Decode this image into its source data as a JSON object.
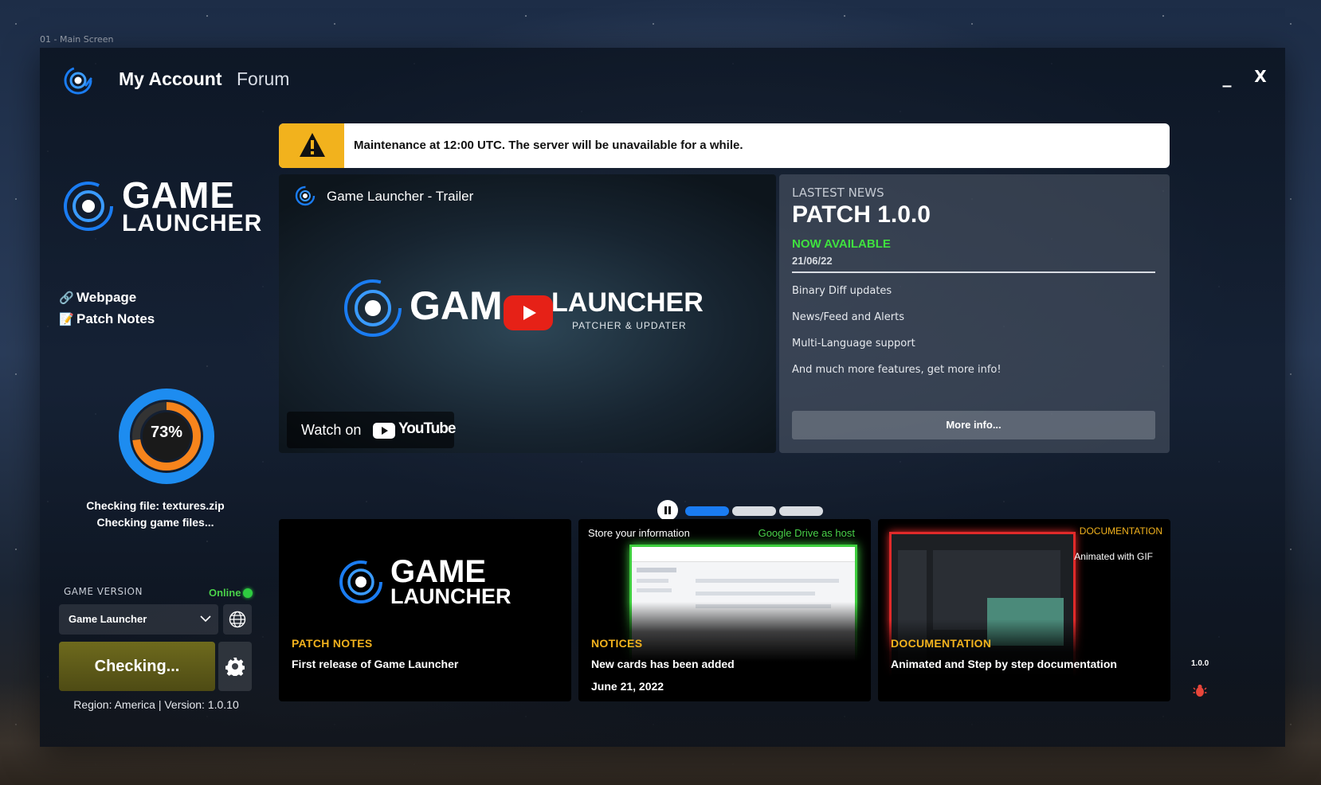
{
  "screen_label": "01 - Main Screen",
  "header": {
    "account": "My Account",
    "forum": "Forum",
    "minimize": "_",
    "close": "X"
  },
  "brand": {
    "line1": "GAME",
    "line2": "LAUNCHER"
  },
  "sidebar": {
    "links": [
      {
        "label": "Webpage",
        "icon": "link-icon"
      },
      {
        "label": "Patch Notes",
        "icon": "notepad-icon"
      }
    ],
    "progress": {
      "percent": "73%",
      "value": 0.73
    },
    "status_line1": "Checking file: textures.zip",
    "status_line2": "Checking game files...",
    "game_version_label": "GAME VERSION",
    "online_label": "Online",
    "selected_game": "Game Launcher",
    "action_button": "Checking...",
    "region_version": "Region: America | Version: 1.0.10"
  },
  "alert": {
    "message": "Maintenance at 12:00 UTC. The server will be unavailable for a while.",
    "icon": "warning-icon",
    "color": "#f2b21d"
  },
  "video": {
    "title": "Game Launcher - Trailer",
    "logo_gam": "GAM",
    "logo_launcher": "LAUNCHER",
    "logo_sub": "PATCHER & UPDATER",
    "watch_on": "Watch on",
    "youtube": "YouTube"
  },
  "news": {
    "kicker": "LASTEST NEWS",
    "title": "PATCH 1.0.0",
    "status": "NOW AVAILABLE",
    "date": "21/06/22",
    "features": [
      "Binary Diff updates",
      "News/Feed and Alerts",
      "Multi-Language support",
      "And much more features, get more info!"
    ],
    "more_button": "More info..."
  },
  "carousel": {
    "active_index": 0,
    "count": 3
  },
  "cards": [
    {
      "category": "PATCH NOTES",
      "text": "First release of Game Launcher",
      "logo1": "GAME",
      "logo2": "LAUNCHER"
    },
    {
      "category": "NOTICES",
      "text": "New cards has been added",
      "date": "June 21, 2022",
      "header_left": "Store your information",
      "header_right": "Google Drive as host"
    },
    {
      "category": "DOCUMENTATION",
      "text": "Animated and Step by step documentation",
      "badge": "DOCUMENTATION",
      "caption": "Animated with GIF"
    }
  ],
  "footer": {
    "version": "1.0.0"
  },
  "colors": {
    "accent_blue": "#1a7cf2",
    "warning": "#f2b21d",
    "online": "#2ecc40",
    "ring_orange": "#f7841c"
  }
}
